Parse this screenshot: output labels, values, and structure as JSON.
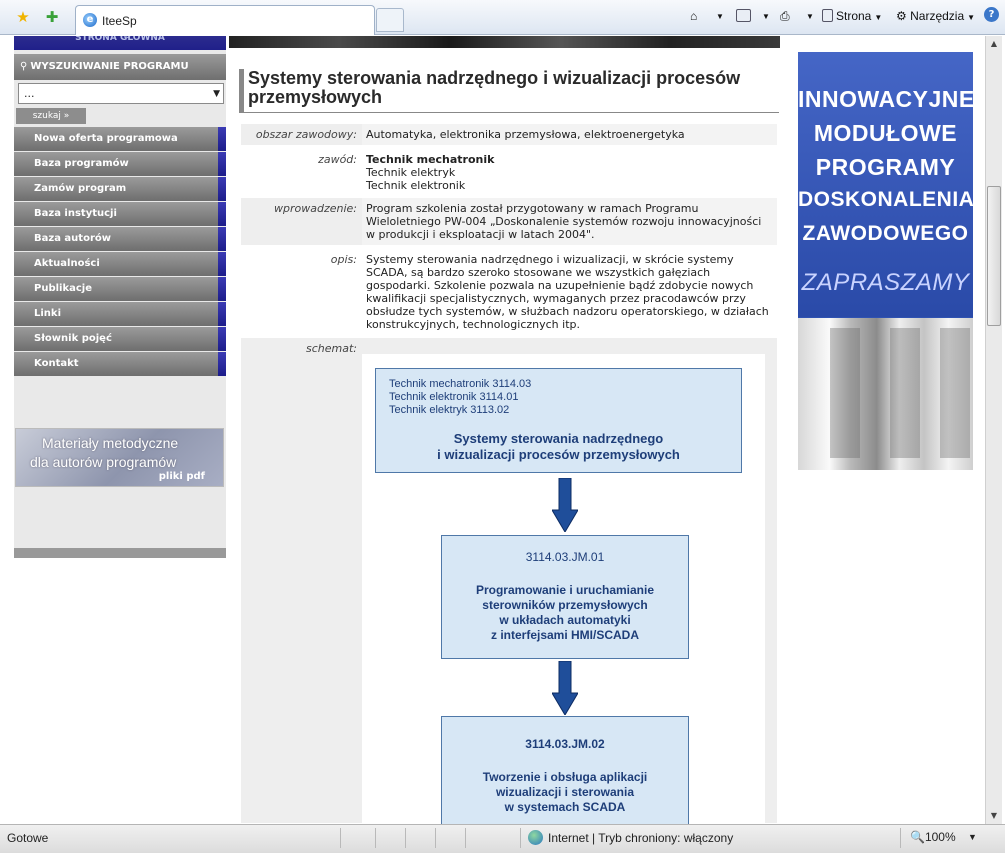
{
  "browser": {
    "tab_title": "IteeSp",
    "toolbar": {
      "strona": "Strona",
      "narzedzia": "Narzędzia"
    },
    "status": {
      "text": "Gotowe",
      "zone": "Internet | Tryb chroniony: włączony",
      "zoom": "100%"
    }
  },
  "left_nav": {
    "home_bar": "STRONA GŁÓWNA",
    "search_header": "WYSZUKIWANIE PROGRAMU",
    "select_value": "...",
    "search_button": "szukaj »",
    "menu": [
      {
        "label": "Nowa oferta programowa"
      },
      {
        "label": "Baza programów"
      },
      {
        "label": "Zamów program"
      },
      {
        "label": "Baza instytucji"
      },
      {
        "label": "Baza autorów"
      },
      {
        "label": "Aktualności"
      },
      {
        "label": "Publikacje"
      },
      {
        "label": "Linki"
      },
      {
        "label": "Słownik pojęć"
      },
      {
        "label": "Kontakt"
      }
    ],
    "materialy": {
      "line1": "Materiały metodyczne",
      "line2": "dla autorów programów",
      "line3": "pliki pdf"
    }
  },
  "main": {
    "title": "Systemy sterowania nadrzędnego i wizualizacji procesów przemysłowych",
    "rows": {
      "obszar": {
        "label": "obszar zawodowy:",
        "value": "Automatyka, elektronika przemysłowa, elektroenergetyka"
      },
      "zawod": {
        "label": "zawód:",
        "primary": "Technik mechatronik",
        "other1": "Technik elektryk",
        "other2": "Technik elektronik"
      },
      "wprowadzenie": {
        "label": "wprowadzenie:",
        "value": "Program szkolenia został przygotowany w ramach Programu Wieloletniego PW-004 „Doskonalenie systemów rozwoju innowacyjności w produkcji i eksploatacji w latach 2004\"."
      },
      "opis": {
        "label": "opis:",
        "value": " Systemy sterowania nadrzędnego i wizualizacji, w skrócie systemy SCADA, są bardzo szeroko stosowane we wszystkich gałęziach gospodarki. Szkolenie pozwala na uzupełnienie bądź zdobycie nowych kwalifikacji specjalistycznych, wymaganych przez pracodawców przy obsłudze tych systemów, w służbach nadzoru operatorskiego, w działach konstrukcyjnych, technologicznych itp."
      },
      "schemat": {
        "label": "schemat:"
      }
    },
    "diagram": {
      "box1": {
        "code1": "Technik mechatronik  3114.03",
        "code2": "Technik elektronik 3114.01",
        "code3": "Technik elektryk  3113.02",
        "title1": "Systemy sterowania nadrzędnego",
        "title2": "i wizualizacji procesów przemysłowych"
      },
      "box2": {
        "code": "3114.03.JM.01",
        "l1": "Programowanie i uruchamianie",
        "l2": "sterowników przemysłowych",
        "l3": "w układach automatyki",
        "l4": "z interfejsami HMI/SCADA"
      },
      "box3": {
        "code": "3114.03.JM.02",
        "l1": "Tworzenie i obsługa aplikacji",
        "l2": "wizualizacji i sterowania",
        "l3": "w systemach SCADA"
      }
    }
  },
  "banner": {
    "l1": "INNOWACYJNE",
    "l2": "MODUŁOWE",
    "l3": "PROGRAMY",
    "l4": "DOSKONALENIA",
    "l5": "ZAWODOWEGO",
    "l6": "ZAPRASZAMY"
  }
}
